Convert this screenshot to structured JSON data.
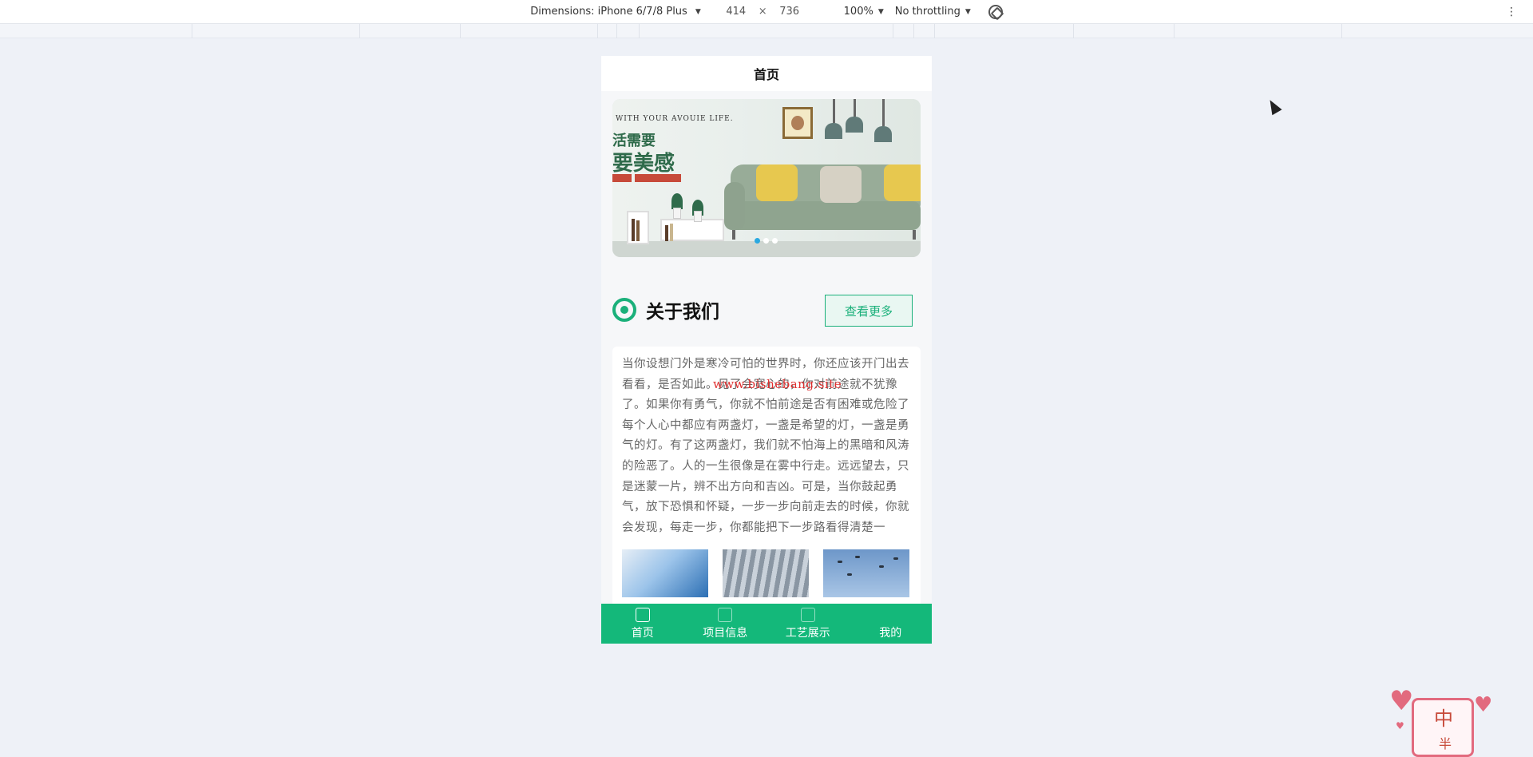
{
  "devtools": {
    "dimensions_label": "Dimensions: iPhone 6/7/8 Plus",
    "width": "414",
    "times": "×",
    "height": "736",
    "zoom": "100%",
    "throttle": "No throttling",
    "more": "⋮"
  },
  "app": {
    "nav_title": "首页",
    "banner": {
      "slogan_en": "WITH YOUR AVOUIE LIFE.",
      "slogan_line1": "活需要",
      "slogan_line2": "要美感",
      "active_dot": 0,
      "dot_count": 3
    },
    "about": {
      "title": "关于我们",
      "more_button": "查看更多",
      "text": "当你设想门外是寒冷可怕的世界时，你还应该开门出去看看，是否如此。见了会宽心的，你对前途就不犹豫了。如果你有勇气，你就不怕前途是否有困难或危险了每个人心中都应有两盏灯，一盏是希望的灯，一盏是勇气的灯。有了这两盏灯，我们就不怕海上的黑暗和风涛的险恶了。人的一生很像是在雾中行走。远远望去，只是迷蒙一片，辨不出方向和吉凶。可是，当你鼓起勇气，放下恐惧和怀疑，一步一步向前走去的时候，你就会发现，每走一步，你都能把下一步路看得清楚一点。“往前走",
      "watermark": "www.bishebang.site"
    },
    "tabbar": [
      {
        "label": "首页",
        "icon": "home-icon",
        "active": true
      },
      {
        "label": "项目信息",
        "icon": "grid-icon",
        "active": false
      },
      {
        "label": "工艺展示",
        "icon": "display-icon",
        "active": false
      },
      {
        "label": "我的",
        "icon": "user-icon",
        "active": false
      }
    ]
  },
  "mascot": {
    "char1": "中",
    "char2": "半"
  },
  "colors": {
    "accent": "#14b87a",
    "background": "#eef1f7"
  }
}
